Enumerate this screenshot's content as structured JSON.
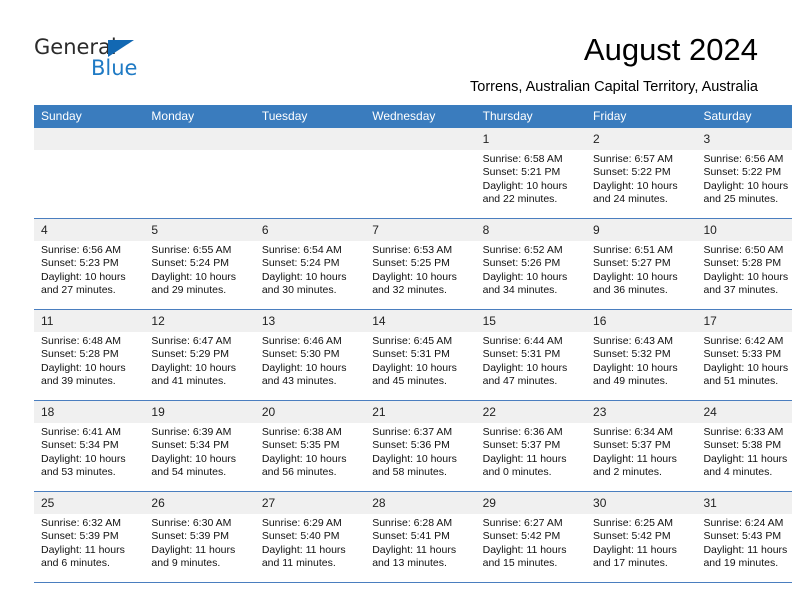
{
  "brand": {
    "word1": "General",
    "word2": "Blue",
    "triangle_icon": "triangle-icon",
    "accent_color": "#1f7ac4"
  },
  "header": {
    "title": "August 2024",
    "subtitle": "Torrens, Australian Capital Territory, Australia"
  },
  "calendar": {
    "header_bg": "#3a7cbe",
    "daynum_bg": "#f0f0f0",
    "row_border": "#4a7ebf",
    "weekdays": [
      "Sunday",
      "Monday",
      "Tuesday",
      "Wednesday",
      "Thursday",
      "Friday",
      "Saturday"
    ],
    "weeks": [
      [
        {
          "day": "",
          "empty": true,
          "lines": []
        },
        {
          "day": "",
          "empty": true,
          "lines": []
        },
        {
          "day": "",
          "empty": true,
          "lines": []
        },
        {
          "day": "",
          "empty": true,
          "lines": []
        },
        {
          "day": "1",
          "empty": false,
          "lines": [
            "Sunrise: 6:58 AM",
            "Sunset: 5:21 PM",
            "Daylight: 10 hours",
            "and 22 minutes."
          ]
        },
        {
          "day": "2",
          "empty": false,
          "lines": [
            "Sunrise: 6:57 AM",
            "Sunset: 5:22 PM",
            "Daylight: 10 hours",
            "and 24 minutes."
          ]
        },
        {
          "day": "3",
          "empty": false,
          "lines": [
            "Sunrise: 6:56 AM",
            "Sunset: 5:22 PM",
            "Daylight: 10 hours",
            "and 25 minutes."
          ]
        }
      ],
      [
        {
          "day": "4",
          "empty": false,
          "lines": [
            "Sunrise: 6:56 AM",
            "Sunset: 5:23 PM",
            "Daylight: 10 hours",
            "and 27 minutes."
          ]
        },
        {
          "day": "5",
          "empty": false,
          "lines": [
            "Sunrise: 6:55 AM",
            "Sunset: 5:24 PM",
            "Daylight: 10 hours",
            "and 29 minutes."
          ]
        },
        {
          "day": "6",
          "empty": false,
          "lines": [
            "Sunrise: 6:54 AM",
            "Sunset: 5:24 PM",
            "Daylight: 10 hours",
            "and 30 minutes."
          ]
        },
        {
          "day": "7",
          "empty": false,
          "lines": [
            "Sunrise: 6:53 AM",
            "Sunset: 5:25 PM",
            "Daylight: 10 hours",
            "and 32 minutes."
          ]
        },
        {
          "day": "8",
          "empty": false,
          "lines": [
            "Sunrise: 6:52 AM",
            "Sunset: 5:26 PM",
            "Daylight: 10 hours",
            "and 34 minutes."
          ]
        },
        {
          "day": "9",
          "empty": false,
          "lines": [
            "Sunrise: 6:51 AM",
            "Sunset: 5:27 PM",
            "Daylight: 10 hours",
            "and 36 minutes."
          ]
        },
        {
          "day": "10",
          "empty": false,
          "lines": [
            "Sunrise: 6:50 AM",
            "Sunset: 5:28 PM",
            "Daylight: 10 hours",
            "and 37 minutes."
          ]
        }
      ],
      [
        {
          "day": "11",
          "empty": false,
          "lines": [
            "Sunrise: 6:48 AM",
            "Sunset: 5:28 PM",
            "Daylight: 10 hours",
            "and 39 minutes."
          ]
        },
        {
          "day": "12",
          "empty": false,
          "lines": [
            "Sunrise: 6:47 AM",
            "Sunset: 5:29 PM",
            "Daylight: 10 hours",
            "and 41 minutes."
          ]
        },
        {
          "day": "13",
          "empty": false,
          "lines": [
            "Sunrise: 6:46 AM",
            "Sunset: 5:30 PM",
            "Daylight: 10 hours",
            "and 43 minutes."
          ]
        },
        {
          "day": "14",
          "empty": false,
          "lines": [
            "Sunrise: 6:45 AM",
            "Sunset: 5:31 PM",
            "Daylight: 10 hours",
            "and 45 minutes."
          ]
        },
        {
          "day": "15",
          "empty": false,
          "lines": [
            "Sunrise: 6:44 AM",
            "Sunset: 5:31 PM",
            "Daylight: 10 hours",
            "and 47 minutes."
          ]
        },
        {
          "day": "16",
          "empty": false,
          "lines": [
            "Sunrise: 6:43 AM",
            "Sunset: 5:32 PM",
            "Daylight: 10 hours",
            "and 49 minutes."
          ]
        },
        {
          "day": "17",
          "empty": false,
          "lines": [
            "Sunrise: 6:42 AM",
            "Sunset: 5:33 PM",
            "Daylight: 10 hours",
            "and 51 minutes."
          ]
        }
      ],
      [
        {
          "day": "18",
          "empty": false,
          "lines": [
            "Sunrise: 6:41 AM",
            "Sunset: 5:34 PM",
            "Daylight: 10 hours",
            "and 53 minutes."
          ]
        },
        {
          "day": "19",
          "empty": false,
          "lines": [
            "Sunrise: 6:39 AM",
            "Sunset: 5:34 PM",
            "Daylight: 10 hours",
            "and 54 minutes."
          ]
        },
        {
          "day": "20",
          "empty": false,
          "lines": [
            "Sunrise: 6:38 AM",
            "Sunset: 5:35 PM",
            "Daylight: 10 hours",
            "and 56 minutes."
          ]
        },
        {
          "day": "21",
          "empty": false,
          "lines": [
            "Sunrise: 6:37 AM",
            "Sunset: 5:36 PM",
            "Daylight: 10 hours",
            "and 58 minutes."
          ]
        },
        {
          "day": "22",
          "empty": false,
          "lines": [
            "Sunrise: 6:36 AM",
            "Sunset: 5:37 PM",
            "Daylight: 11 hours",
            "and 0 minutes."
          ]
        },
        {
          "day": "23",
          "empty": false,
          "lines": [
            "Sunrise: 6:34 AM",
            "Sunset: 5:37 PM",
            "Daylight: 11 hours",
            "and 2 minutes."
          ]
        },
        {
          "day": "24",
          "empty": false,
          "lines": [
            "Sunrise: 6:33 AM",
            "Sunset: 5:38 PM",
            "Daylight: 11 hours",
            "and 4 minutes."
          ]
        }
      ],
      [
        {
          "day": "25",
          "empty": false,
          "lines": [
            "Sunrise: 6:32 AM",
            "Sunset: 5:39 PM",
            "Daylight: 11 hours",
            "and 6 minutes."
          ]
        },
        {
          "day": "26",
          "empty": false,
          "lines": [
            "Sunrise: 6:30 AM",
            "Sunset: 5:39 PM",
            "Daylight: 11 hours",
            "and 9 minutes."
          ]
        },
        {
          "day": "27",
          "empty": false,
          "lines": [
            "Sunrise: 6:29 AM",
            "Sunset: 5:40 PM",
            "Daylight: 11 hours",
            "and 11 minutes."
          ]
        },
        {
          "day": "28",
          "empty": false,
          "lines": [
            "Sunrise: 6:28 AM",
            "Sunset: 5:41 PM",
            "Daylight: 11 hours",
            "and 13 minutes."
          ]
        },
        {
          "day": "29",
          "empty": false,
          "lines": [
            "Sunrise: 6:27 AM",
            "Sunset: 5:42 PM",
            "Daylight: 11 hours",
            "and 15 minutes."
          ]
        },
        {
          "day": "30",
          "empty": false,
          "lines": [
            "Sunrise: 6:25 AM",
            "Sunset: 5:42 PM",
            "Daylight: 11 hours",
            "and 17 minutes."
          ]
        },
        {
          "day": "31",
          "empty": false,
          "lines": [
            "Sunrise: 6:24 AM",
            "Sunset: 5:43 PM",
            "Daylight: 11 hours",
            "and 19 minutes."
          ]
        }
      ]
    ]
  }
}
